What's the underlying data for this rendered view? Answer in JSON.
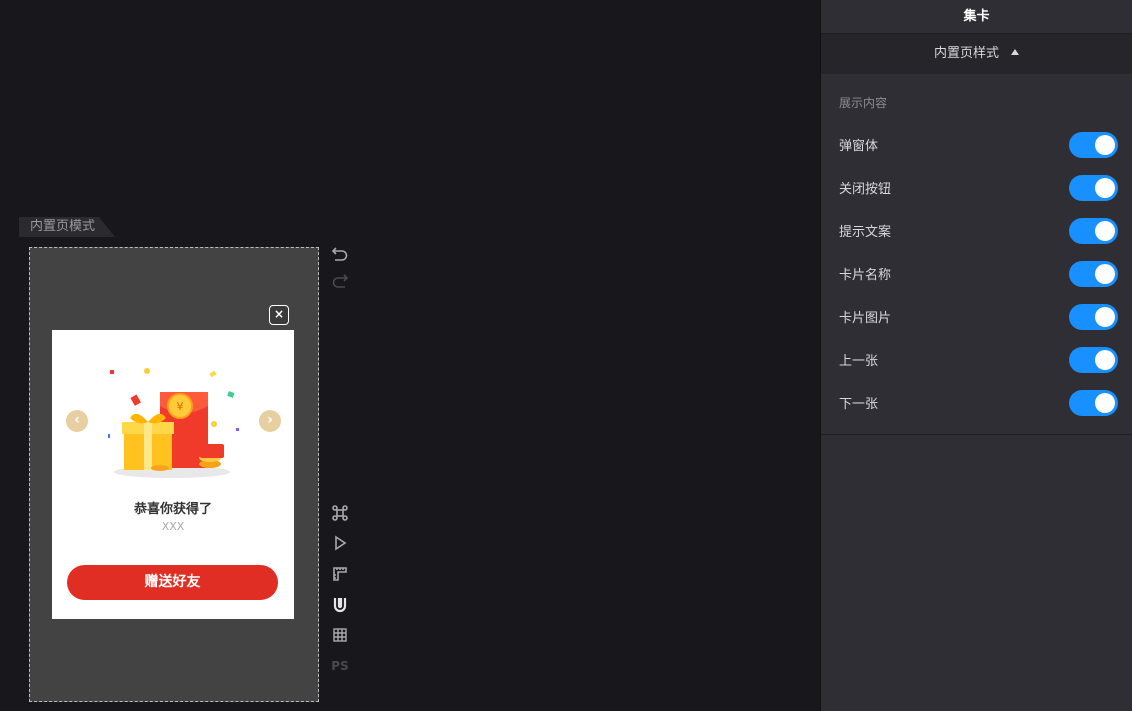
{
  "canvas": {
    "mode_tab": "内置页模式",
    "close_glyph": "×",
    "prev_glyph": "‹",
    "next_glyph": "›",
    "card_title": "恭喜你获得了",
    "card_subtitle": "XXX",
    "gift_button": "赠送好友"
  },
  "toolbar": {
    "ps_label": "PS"
  },
  "panel": {
    "title": "集卡",
    "section_title": "内置页样式",
    "group_label": "展示内容",
    "toggles": [
      {
        "label": "弹窗体",
        "on": true
      },
      {
        "label": "关闭按钮",
        "on": true
      },
      {
        "label": "提示文案",
        "on": true
      },
      {
        "label": "卡片名称",
        "on": true
      },
      {
        "label": "卡片图片",
        "on": true
      },
      {
        "label": "上一张",
        "on": true
      },
      {
        "label": "下一张",
        "on": true
      }
    ]
  },
  "colors": {
    "accent": "#1890ff",
    "button_red": "#e02e24",
    "arrow_gold": "#e8cfa2"
  }
}
